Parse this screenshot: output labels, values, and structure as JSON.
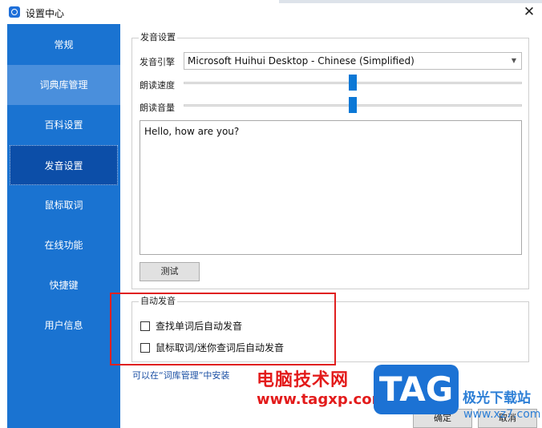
{
  "window": {
    "title": "设置中心",
    "close_glyph": "✕"
  },
  "sidebar": {
    "items": [
      {
        "label": "常规",
        "state": "normal"
      },
      {
        "label": "词典库管理",
        "state": "hover"
      },
      {
        "label": "百科设置",
        "state": "normal"
      },
      {
        "label": "发音设置",
        "state": "active"
      },
      {
        "label": "鼠标取词",
        "state": "normal"
      },
      {
        "label": "在线功能",
        "state": "normal"
      },
      {
        "label": "快捷键",
        "state": "normal"
      },
      {
        "label": "用户信息",
        "state": "normal"
      }
    ]
  },
  "pronunciation": {
    "group_title": "发音设置",
    "engine_label": "发音引擎",
    "engine_value": "Microsoft Huihui Desktop - Chinese (Simplified)",
    "speed_label": "朗读速度",
    "speed_value": 0.5,
    "volume_label": "朗读音量",
    "volume_value": 0.5,
    "sample_text": "Hello, how are you?",
    "test_button": "测试"
  },
  "auto_pronounce": {
    "group_title": "自动发音",
    "options": [
      {
        "label": "查找单词后自动发音",
        "checked": false
      },
      {
        "label": "鼠标取词/迷你查词后自动发音",
        "checked": false
      }
    ]
  },
  "hint": "可以在“词库管理”中安装",
  "footer": {
    "ok_label": "确定",
    "cancel_label": "取消"
  },
  "watermark": {
    "cn": "电脑技术网",
    "url": "www.tagxp.com",
    "tag": "TAG",
    "xz": "极光下载站",
    "xz_url": "www.xz7.com"
  },
  "colors": {
    "sidebar_bg": "#1a73d1",
    "sidebar_active": "#0c4ea8",
    "slider_thumb": "#0b78d6",
    "highlight_box": "#e02020"
  }
}
